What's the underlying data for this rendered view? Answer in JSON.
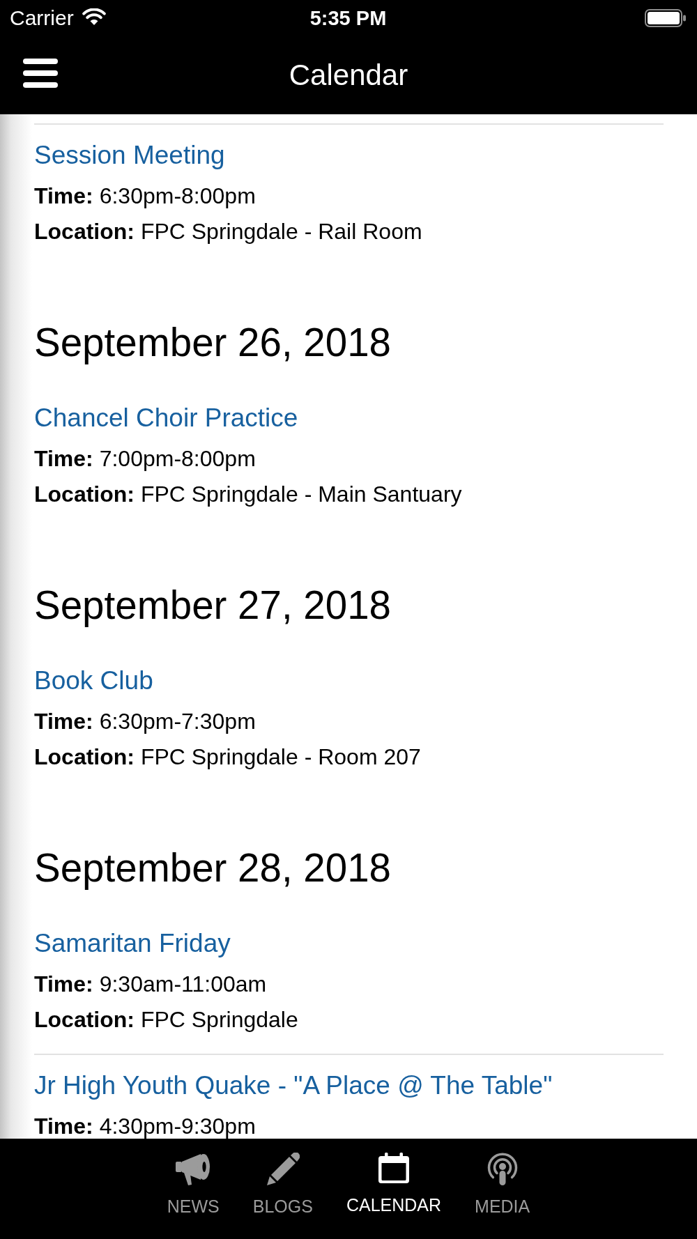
{
  "status_bar": {
    "carrier": "Carrier",
    "time": "5:35 PM"
  },
  "nav_bar": {
    "title": "Calendar"
  },
  "days": [
    {
      "events": [
        {
          "title": "Session Meeting",
          "time": "**Time:** 6:30pm-8:00pm",
          "location": "**Location:** FPC Springdale - Rail Room"
        }
      ]
    },
    {
      "date": "September 26, 2018",
      "events": [
        {
          "title": "Chancel Choir Practice",
          "time": "**Time:** 7:00pm-8:00pm",
          "location": "**Location:** FPC Springdale - Main Santuary"
        }
      ]
    },
    {
      "date": "September 27, 2018",
      "events": [
        {
          "title": "Book Club",
          "time": "**Time:** 6:30pm-7:30pm",
          "location": "**Location:** FPC Springdale - Room 207"
        }
      ]
    },
    {
      "date": "September 28, 2018",
      "events": [
        {
          "title": "Samaritan Friday",
          "time": "**Time:** 9:30am-11:00am",
          "location": "**Location:** FPC Springdale"
        },
        {
          "title": "Jr High Youth Quake - \"A Place @ The Table\"",
          "time": "**Time:** 4:30pm-9:30pm"
        }
      ]
    }
  ],
  "tab_bar": [
    {
      "label": "NEWS",
      "selected": false
    },
    {
      "label": "BLOGS",
      "selected": false
    },
    {
      "label": "CALENDAR",
      "selected": true
    },
    {
      "label": "MEDIA",
      "selected": false
    }
  ]
}
